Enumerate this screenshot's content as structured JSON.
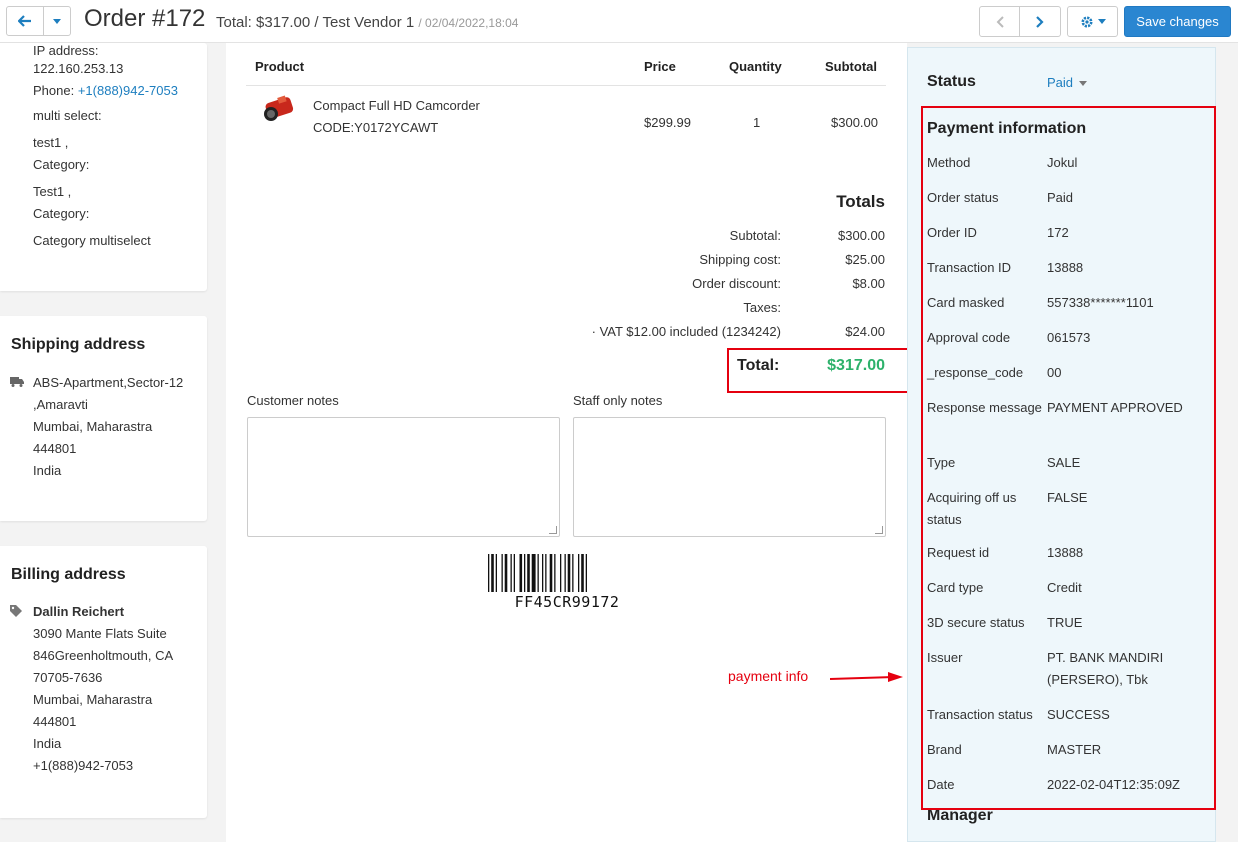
{
  "header": {
    "title": "Order #172",
    "meta": "Total: $317.00 / Test Vendor 1",
    "date": "/ 02/04/2022,18:04",
    "save_label": "Save changes"
  },
  "customer": {
    "ip_label": "IP address:",
    "ip_value": "122.160.253.13",
    "phone_label": "Phone:",
    "phone_value": "+1(888)942-7053",
    "multi_select_label": "multi select:",
    "test1a": "test1 ,",
    "category1": "Category:",
    "test1b": "Test1 ,",
    "category2": "Category:",
    "category_multiselect": "Category multiselect"
  },
  "shipping": {
    "title": "Shipping address",
    "lines": [
      "ABS-Apartment,Sector-12",
      ",Amaravti",
      "Mumbai, Maharastra",
      "444801",
      "India"
    ]
  },
  "billing": {
    "title": "Billing address",
    "name": "Dallin Reichert",
    "lines": [
      "3090 Mante Flats Suite",
      "846Greenholtmouth, CA",
      "70705-7636",
      "Mumbai, Maharastra",
      "444801",
      "India"
    ],
    "phone": "+1(888)942-7053"
  },
  "products": {
    "headers": {
      "product": "Product",
      "price": "Price",
      "quantity": "Quantity",
      "subtotal": "Subtotal"
    },
    "rows": [
      {
        "name": "Compact Full HD Camcorder",
        "code": "CODE:Y0172YCAWT",
        "price": "$299.99",
        "quantity": "1",
        "subtotal": "$300.00"
      }
    ]
  },
  "totals": {
    "title": "Totals",
    "rows": [
      {
        "label": "Subtotal:",
        "value": "$300.00"
      },
      {
        "label": "Shipping cost:",
        "value": "$25.00"
      },
      {
        "label": "Order discount:",
        "value": "$8.00"
      },
      {
        "label": "Taxes:",
        "value": ""
      },
      {
        "label": "· VAT  $12.00  included (1234242)",
        "value": "$24.00"
      }
    ],
    "total_label": "Total:",
    "total_value": "$317.00",
    "total_color": "#2db16b"
  },
  "notes": {
    "customer_label": "Customer notes",
    "staff_label": "Staff only notes"
  },
  "barcode": {
    "text": "FF45CR99172"
  },
  "status": {
    "label": "Status",
    "value": "Paid"
  },
  "payment": {
    "title": "Payment information",
    "rows": [
      {
        "label": "Method",
        "value": "Jokul"
      },
      {
        "label": "Order status",
        "value": "Paid"
      },
      {
        "label": "Order ID",
        "value": "172"
      },
      {
        "label": "Transaction ID",
        "value": "13888"
      },
      {
        "label": "Card masked",
        "value": "557338*******1101"
      },
      {
        "label": "Approval code",
        "value": "061573"
      },
      {
        "label": "_response_code",
        "value": "00"
      },
      {
        "label": "Response message",
        "value": "PAYMENT APPROVED"
      },
      {
        "label": "Type",
        "value": "SALE"
      },
      {
        "label": "Acquiring off us status",
        "value": "FALSE"
      },
      {
        "label": "Request id",
        "value": "13888"
      },
      {
        "label": "Card type",
        "value": "Credit"
      },
      {
        "label": "3D secure status",
        "value": "TRUE"
      },
      {
        "label": "Issuer",
        "value": "PT. BANK MANDIRI (PERSERO), Tbk"
      },
      {
        "label": "Transaction status",
        "value": "SUCCESS"
      },
      {
        "label": "Brand",
        "value": "MASTER"
      },
      {
        "label": "Date",
        "value": "2022-02-04T12:35:09Z"
      }
    ]
  },
  "manager_label": "Manager",
  "annotation": {
    "text": "payment info",
    "color": "#e5000f"
  },
  "colors": {
    "accent": "#2a86d1",
    "link": "#1d7ebf",
    "highlight": "#e5000f"
  }
}
